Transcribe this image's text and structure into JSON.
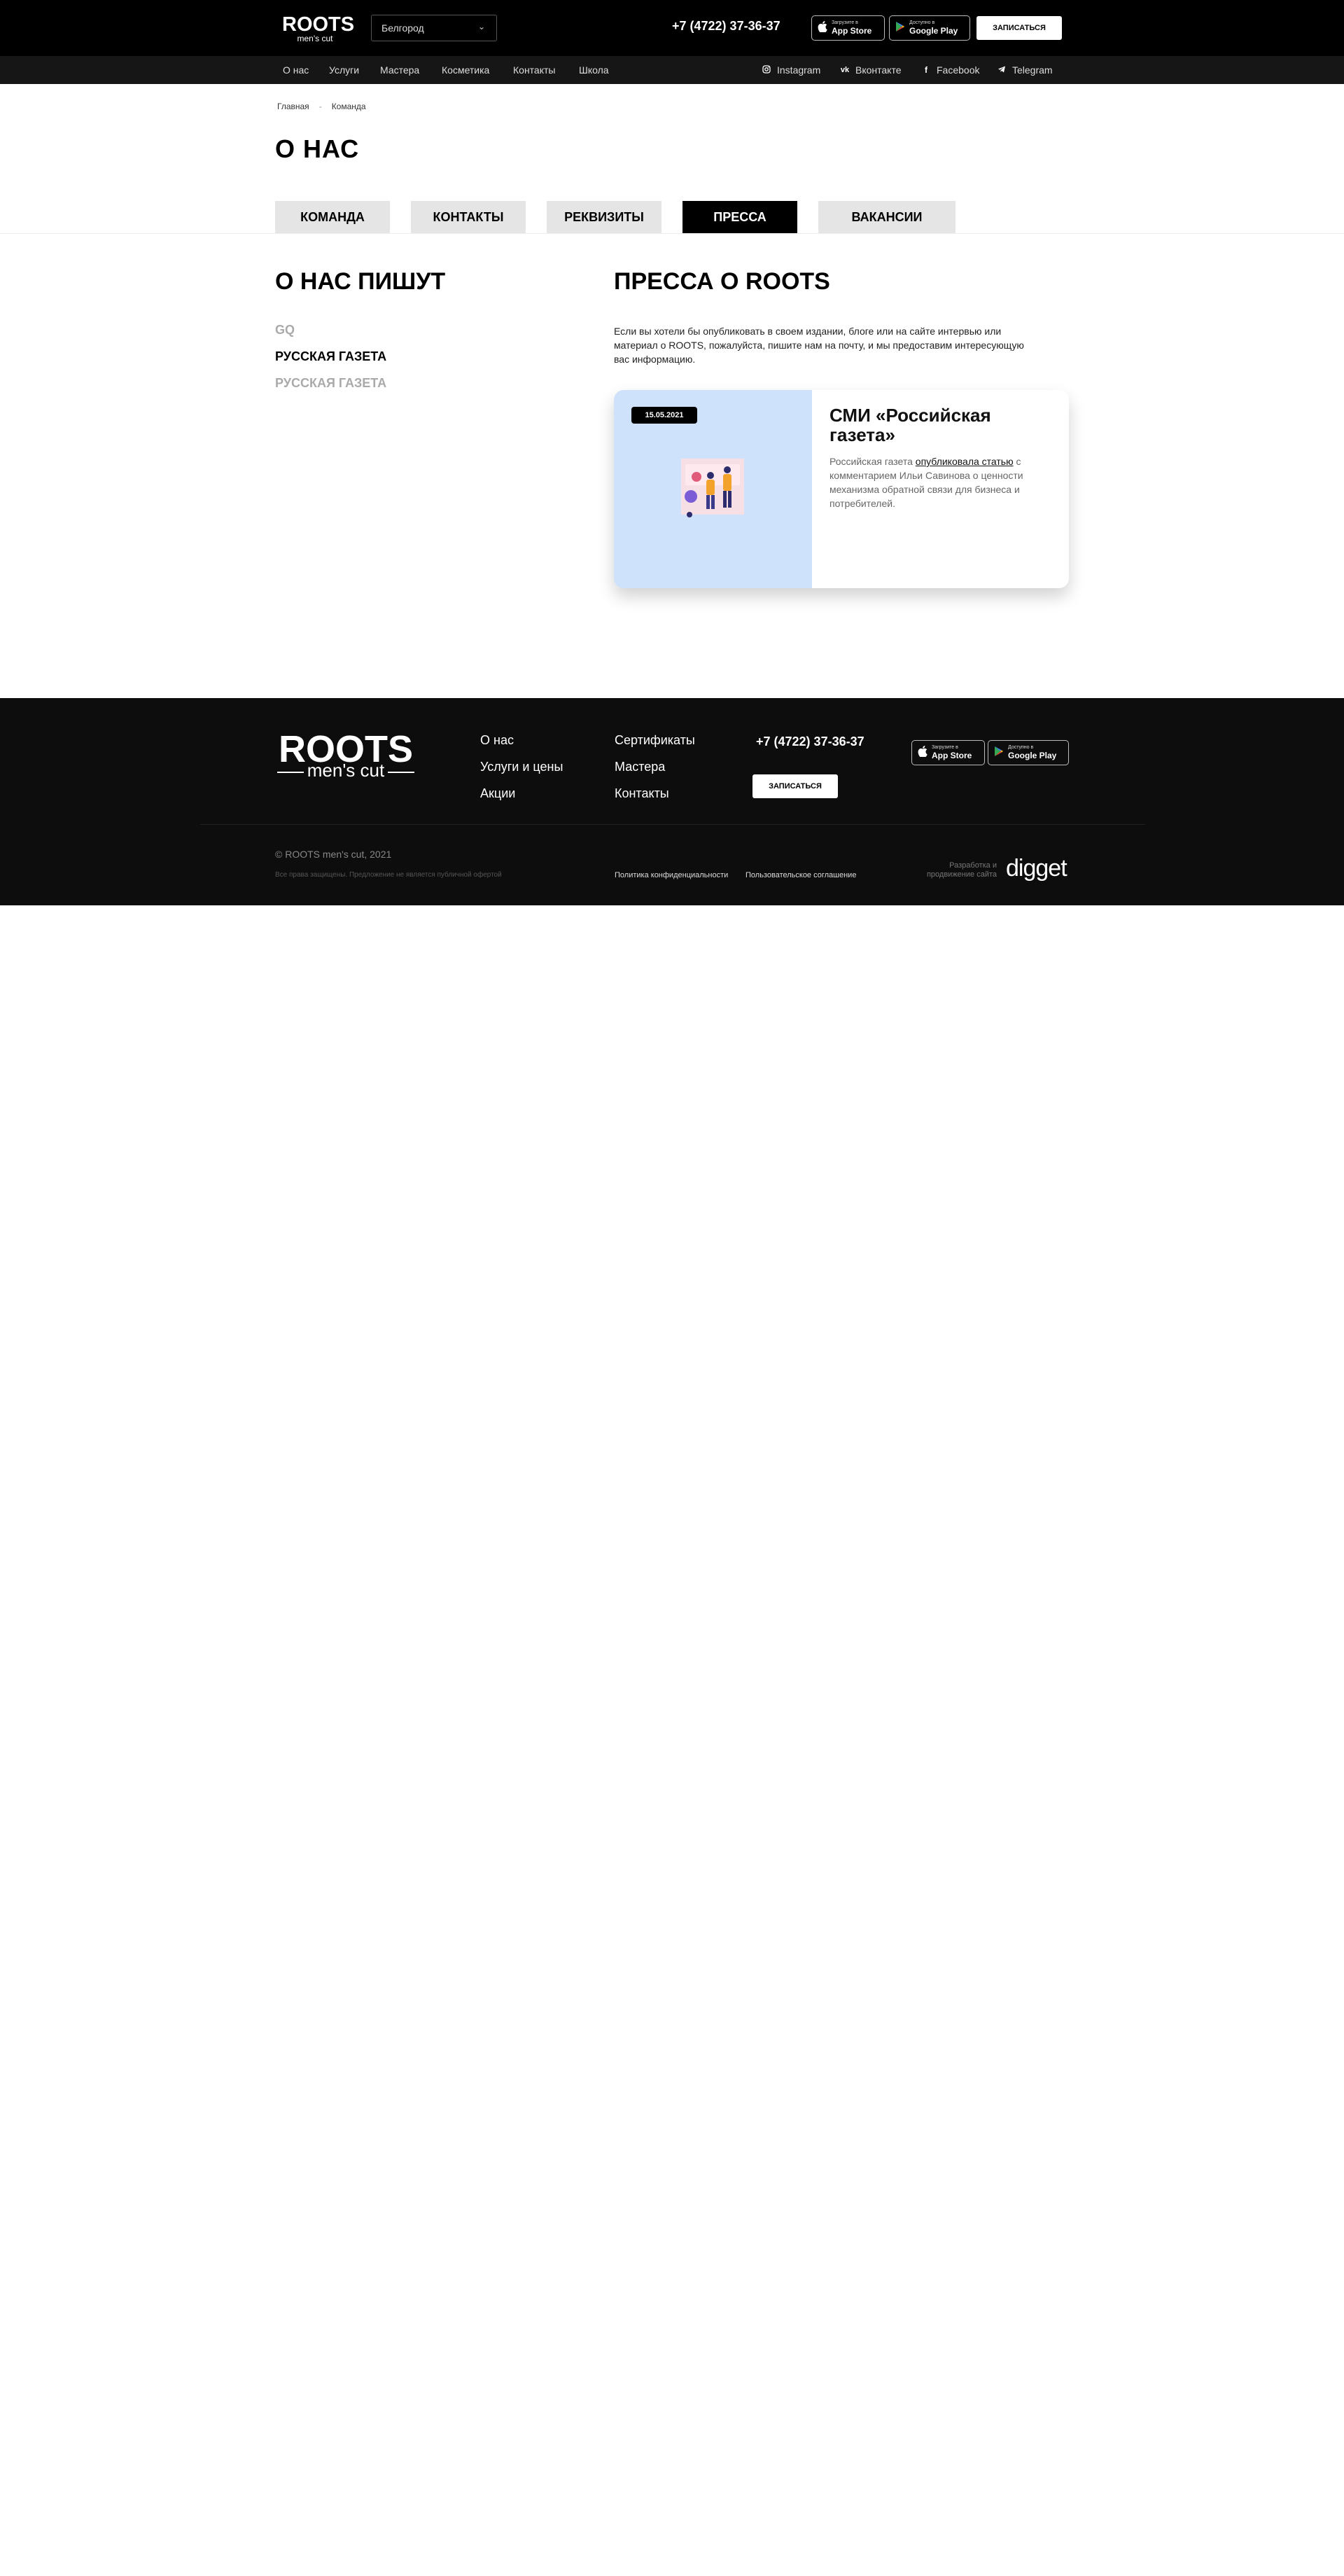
{
  "header": {
    "logo_main": "ROOTS",
    "logo_sub": "men's cut",
    "city": "Белгород",
    "phone": "+7 (4722) 37-36-37",
    "app_store": {
      "small": "Загрузите в",
      "big": "App Store"
    },
    "google_play": {
      "small": "Доступно в",
      "big": "Google Play"
    },
    "book_label": "ЗАПИСАТЬСЯ"
  },
  "nav": {
    "items": [
      "О нас",
      "Услуги",
      "Мастера",
      "Косметика",
      "Контакты",
      "Школа"
    ],
    "social": [
      "Instagram",
      "Вконтакте",
      "Facebook",
      "Telegram"
    ]
  },
  "breadcrumbs": [
    "Главная",
    "Команда"
  ],
  "page_title": "О НАС",
  "tabs": [
    "КОМАНДА",
    "КОНТАКТЫ",
    "РЕКВИЗИТЫ",
    "ПРЕССА",
    "ВАКАНСИИ"
  ],
  "sidebar": {
    "title": "О НАС ПИШУТ",
    "items": [
      "GQ",
      "РУССКАЯ ГАЗЕТА",
      "РУССКАЯ ГАЗЕТА"
    ]
  },
  "main": {
    "title": "ПРЕССА О ROOTS",
    "intro": "Если вы хотели бы опубликовать в своем издании, блоге или на сайте интервью или материал о ROOTS, пожалуйста, пишите нам на почту, и мы предоставим интересующую вас информацию.",
    "card": {
      "date": "15.05.2021",
      "title": "СМИ «Российская газета»",
      "text_before": "Российская газета ",
      "link": "опубликовала статью",
      "text_after": " с комментарием Ильи Савинова о ценности механизма обратной связи для бизнеса и потребителей."
    }
  },
  "footer": {
    "logo_main": "ROOTS",
    "logo_sub": "men's cut",
    "col1": [
      "О нас",
      "Услуги и цены",
      "Акции"
    ],
    "col2": [
      "Сертификаты",
      "Мастера",
      "Контакты"
    ],
    "phone": "+7 (4722) 37-36-37",
    "book_label": "ЗАПИСАТЬСЯ",
    "copyright": "© ROOTS men's cut, 2021",
    "rights": "Все права защищены. Предложение не является публичной офертой",
    "privacy": "Политика конфиденциальности",
    "agreement": "Пользовательское соглашение",
    "developer_line1": "Разработка и",
    "developer_line2": "продвижение сайта",
    "developer_brand": "digget"
  },
  "colors": {
    "header_bg": "#000000",
    "navbar_bg": "#161616",
    "tab_bg": "#e5e5e5",
    "card_image_bg": "#cfe2fc",
    "footer_bg": "#0d0d0d"
  }
}
